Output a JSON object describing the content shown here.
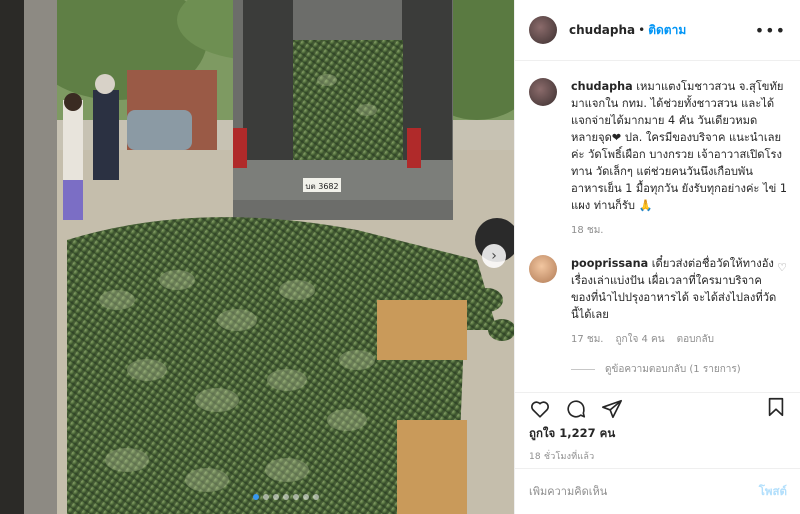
{
  "header": {
    "username": "chudapha",
    "separator": "•",
    "follow_label": "ติดตาม",
    "more_label": "•••"
  },
  "caption": {
    "username": "chudapha",
    "text": "เหมาแตงโมชาวสวน จ.สุโขทัย มาแจกใน กทม. ได้ช่วยทั้งชาวสวน และได้แจกจ่ายได้มากมาย 4 คัน วันเดียวหมด หลายจุด❤ ปล. ใครมีของบริจาค แนะนำเลยค่ะ วัดโพธิ์เผือก บางกรวย เจ้าอาวาสเปิดโรงทาน วัดเล็กๆ แต่ช่วยคนวันนึงเกือบพัน อาหารเย็น 1 มื้อทุกวัน ยังรับทุกอย่างค่ะ ไข่ 1 แผง ท่านก็รับ 🙏",
    "time": "18 ชม."
  },
  "comment": {
    "username": "pooprissana",
    "text": "เดี๋ยวส่งต่อชื่อวัดให้ทางอัง เรื่องเล่าแบ่งปัน เผื่อเวลาที่ใครมาบริจาคของที่นำไปปรุงอาหารได้ จะได้ส่งไปลงที่วัดนี้ได้เลย",
    "time": "17 ชม.",
    "likes": "ถูกใจ 4 คน",
    "reply_label": "ตอบกลับ",
    "view_replies": "ดูข้อความตอบกลับ (1 รายการ)",
    "heart_icon": "♡"
  },
  "photo": {
    "next_arrow": "›",
    "dot_count": 7,
    "active_dot": 0
  },
  "actions": {
    "likes_text": "ถูกใจ 1,227 คน",
    "timestamp": "18 ชั่วโมงที่แล้ว"
  },
  "add_comment": {
    "placeholder": "เพิ่มความคิดเห็น",
    "post_label": "โพสต์"
  },
  "photo_scene": {
    "truck_plate": "บต 3682"
  },
  "colors": {
    "accent": "#0095f6",
    "post_disabled": "#b2dffc",
    "muted": "#8e8e8e",
    "active_dot": "#3897f0"
  }
}
